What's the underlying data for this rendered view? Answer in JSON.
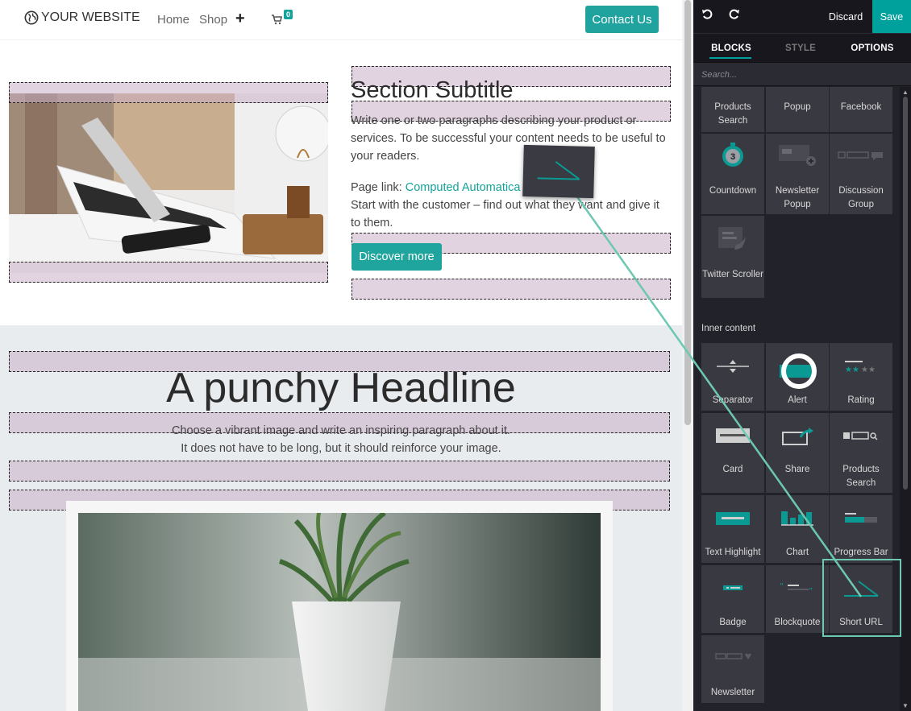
{
  "site": {
    "logo_text": "YOUR WEBSITE",
    "nav": {
      "home": "Home",
      "shop": "Shop",
      "plus": "+",
      "cart_count": "0"
    },
    "contact_label": "Contact Us",
    "section1": {
      "subtitle": "Section Subtitle",
      "paragraph": "Write one or two paragraphs describing your product or services. To be successful your content needs to be useful to your readers.",
      "page_link_prefix": "Page link: ",
      "page_link_text": "Computed Automatica",
      "paragraph2": "Start with the customer – find out what they want and give it to them.",
      "button_label": "Discover more"
    },
    "section2": {
      "headline": "A punchy Headline",
      "line1": "Choose a vibrant image and write an inspiring paragraph about it.",
      "line2": "It does not have to be long, but it should reinforce your image."
    }
  },
  "editor": {
    "undo_icon": "undo-icon",
    "redo_icon": "redo-icon",
    "discard_label": "Discard",
    "save_label": "Save",
    "tabs": [
      "BLOCKS",
      "STYLE",
      "OPTIONS"
    ],
    "active_tab": "BLOCKS",
    "search_placeholder": "Search...",
    "dynamic_blocks": [
      {
        "label": "Products Search"
      },
      {
        "label": "Popup"
      },
      {
        "label": "Facebook"
      },
      {
        "label": "Countdown"
      },
      {
        "label": "Newsletter Popup"
      },
      {
        "label": "Discussion Group"
      },
      {
        "label": "Twitter Scroller"
      }
    ],
    "inner_content_title": "Inner content",
    "inner_blocks": [
      {
        "label": "Separator"
      },
      {
        "label": "Alert"
      },
      {
        "label": "Rating"
      },
      {
        "label": "Card"
      },
      {
        "label": "Share"
      },
      {
        "label": "Products Search"
      },
      {
        "label": "Text Highlight"
      },
      {
        "label": "Chart"
      },
      {
        "label": "Progress Bar"
      },
      {
        "label": "Badge"
      },
      {
        "label": "Blockquote"
      },
      {
        "label": "Short URL"
      },
      {
        "label": "Newsletter"
      }
    ],
    "dragging_block": "Short URL",
    "accent_color": "#00a09d"
  }
}
